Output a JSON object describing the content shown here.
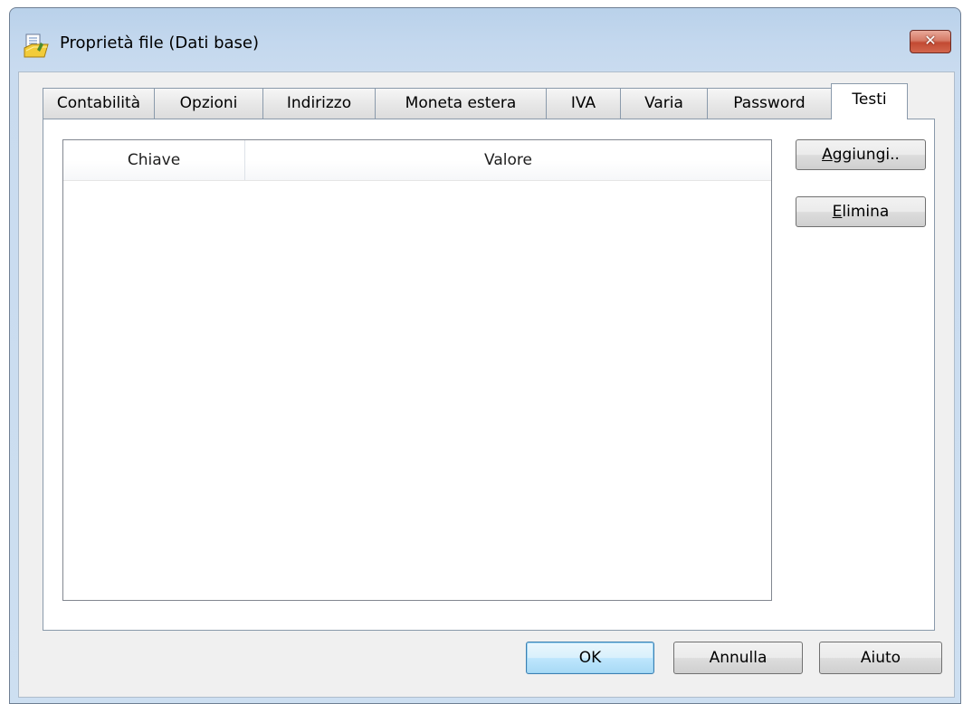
{
  "window": {
    "title": "Proprietà file (Dati base)",
    "close_glyph": "✕"
  },
  "tabs": [
    {
      "label": "Contabilità"
    },
    {
      "label": "Opzioni"
    },
    {
      "label": "Indirizzo"
    },
    {
      "label": "Moneta estera"
    },
    {
      "label": "IVA"
    },
    {
      "label": "Varia"
    },
    {
      "label": "Password"
    },
    {
      "label": "Testi",
      "active": true
    }
  ],
  "list": {
    "columns": [
      "Chiave",
      "Valore"
    ],
    "rows": []
  },
  "side_buttons": {
    "add": {
      "mnemonic": "A",
      "rest": "ggiungi.."
    },
    "delete": {
      "mnemonic": "E",
      "rest": "limina"
    }
  },
  "footer": {
    "ok": "OK",
    "cancel": "Annulla",
    "help": "Aiuto"
  },
  "colors": {
    "frame": "#b9d1ea",
    "client": "#f0f0f0",
    "close_button": "#c24a33",
    "default_button_border": "#3c7fb1"
  },
  "icons": {
    "app": "document-folder-icon",
    "close": "close-icon"
  }
}
